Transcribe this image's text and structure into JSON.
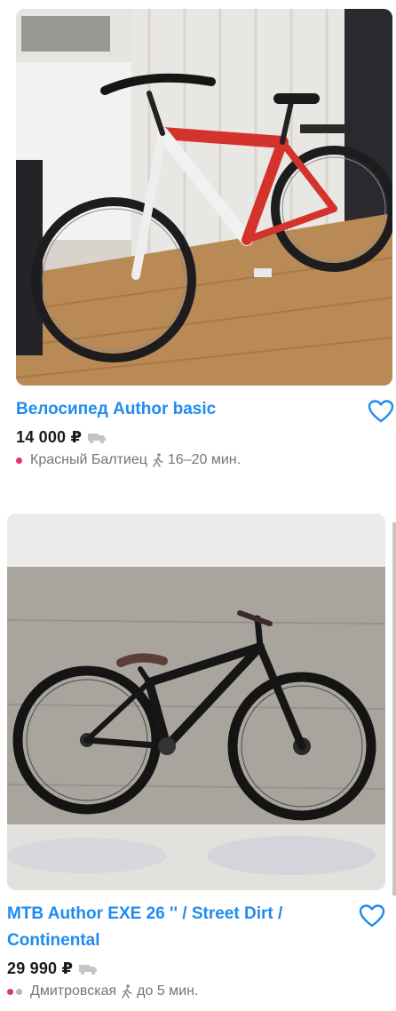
{
  "listings": [
    {
      "title": "Велосипед Author basic",
      "price": "14 000 ₽",
      "metro_station": "Красный Балтиец",
      "metro_colors": [
        "#e0336f"
      ],
      "walk_time": "16–20 мин.",
      "image_subject": "red-white-mountain-bike"
    },
    {
      "title": "MTB Author EXE 26 '' / Street Dirt / Continental",
      "price": "29 990 ₽",
      "metro_station": "Дмитровская",
      "metro_colors": [
        "#d9386b",
        "#b7b7b7"
      ],
      "walk_time": "до 5 мин.",
      "image_subject": "black-dirt-bike"
    }
  ],
  "icons": {
    "favorite": "heart-outline-icon",
    "delivery": "truck-icon",
    "walk": "walking-person-icon"
  },
  "colors": {
    "title": "#1f8bf0",
    "price": "#1a1a1a",
    "meta": "#757575"
  }
}
